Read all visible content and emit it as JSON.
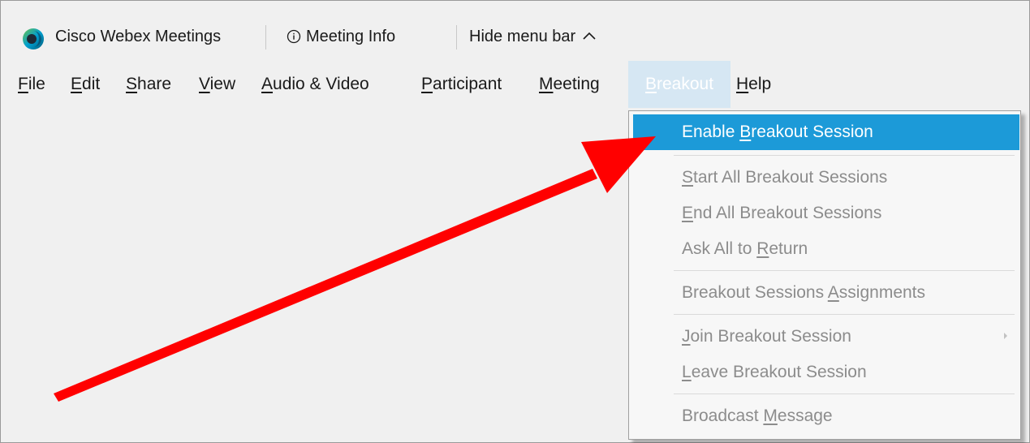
{
  "titlebar": {
    "app_name": "Cisco Webex Meetings",
    "meeting_info": "Meeting Info",
    "hide_menu_bar": "Hide menu bar"
  },
  "menubar": {
    "items": [
      {
        "label": "File",
        "underline": "F",
        "rest": "ile"
      },
      {
        "label": "Edit",
        "underline": "E",
        "rest": "dit"
      },
      {
        "label": "Share",
        "underline": "S",
        "rest": "hare"
      },
      {
        "label": "View",
        "underline": "V",
        "rest": "iew"
      },
      {
        "label": "Audio & Video",
        "underline": "A",
        "rest": "udio & Video"
      },
      {
        "label": "Participant",
        "underline": "P",
        "rest": "articipant"
      },
      {
        "label": "Meeting",
        "underline": "M",
        "rest": "eeting"
      },
      {
        "label": "Breakout",
        "underline": "B",
        "rest": "reakout"
      },
      {
        "label": "Help",
        "underline": "H",
        "rest": "elp"
      }
    ]
  },
  "breakout_menu": {
    "items": [
      {
        "pre": "Enable ",
        "underline": "B",
        "post": "reakout Session",
        "state": "highlighted"
      },
      {
        "pre": "",
        "underline": "S",
        "post": "tart All Breakout Sessions",
        "state": "disabled"
      },
      {
        "pre": "",
        "underline": "E",
        "post": "nd All Breakout Sessions",
        "state": "disabled"
      },
      {
        "pre": "Ask All to ",
        "underline": "R",
        "post": "eturn",
        "state": "disabled"
      },
      {
        "pre": "Breakout Sessions ",
        "underline": "A",
        "post": "ssignments",
        "state": "disabled"
      },
      {
        "pre": "",
        "underline": "J",
        "post": "oin Breakout Session",
        "state": "disabled",
        "submenu": true
      },
      {
        "pre": "",
        "underline": "L",
        "post": "eave Breakout Session",
        "state": "disabled"
      },
      {
        "pre": "Broadcast ",
        "underline": "M",
        "post": "essage",
        "state": "disabled"
      }
    ]
  },
  "colors": {
    "highlight": "#1c9ad8",
    "disabled_text": "#8c8c8c",
    "annotation_arrow": "#ff0000",
    "active_menu_bg": "#d6e7f3"
  },
  "icons": {
    "logo": "webex-logo-icon",
    "info": "info-circle-icon",
    "chevron": "chevron-up-icon",
    "submenu": "chevron-right-icon"
  }
}
